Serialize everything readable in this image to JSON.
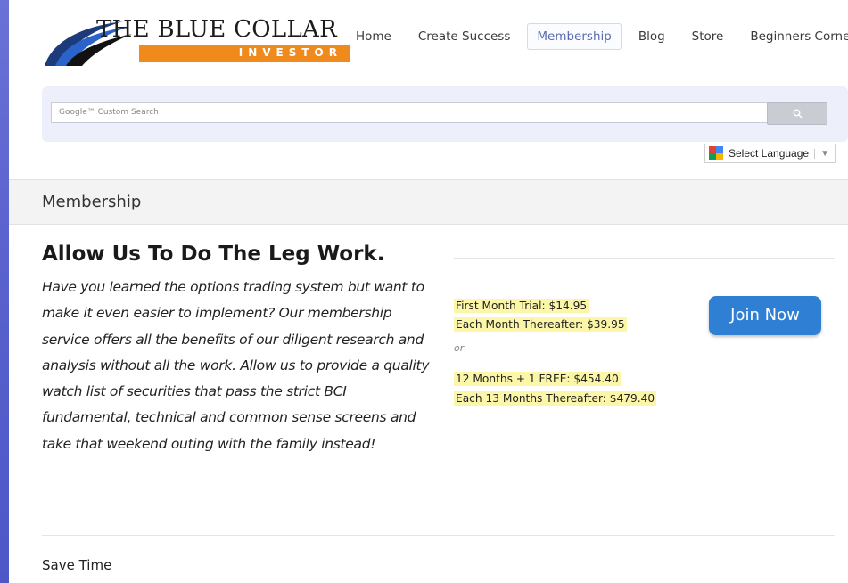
{
  "logo": {
    "title": "THE BLUE COLLAR",
    "subtitle": "INVESTOR"
  },
  "nav": [
    "Home",
    "Create Success",
    "Membership",
    "Blog",
    "Store",
    "Beginners Corner"
  ],
  "nav_active": "Membership",
  "search": {
    "placeholder": "Google™ Custom Search",
    "button_icon": "search-icon"
  },
  "language": {
    "label": "Select Language"
  },
  "page_title": "Membership",
  "content": {
    "heading": "Allow Us To Do The Leg Work.",
    "paragraph": "Have you learned the options trading system but want to make it even easier to implement? Our membership service offers all the benefits of our diligent research and analysis without all the work. Allow us to provide a quality watch list of securities that pass the strict BCI fundamental, technical and common sense screens and take that weekend outing with the family instead!"
  },
  "pricing": {
    "monthly_trial": "First Month Trial: $14.95",
    "monthly_after": "Each Month Thereafter: $39.95",
    "or": "or",
    "annual": "12 Months + 1 FREE: $454.40",
    "annual_after": "Each 13 Months Thereafter: $479.40",
    "join_label": "Join Now"
  },
  "next_section": "Save Time",
  "colors": {
    "accent_orange": "#f08a1d",
    "join_blue": "#2f7fd4",
    "highlight": "#fbf6a8",
    "background_blue": "#5a63cf"
  }
}
